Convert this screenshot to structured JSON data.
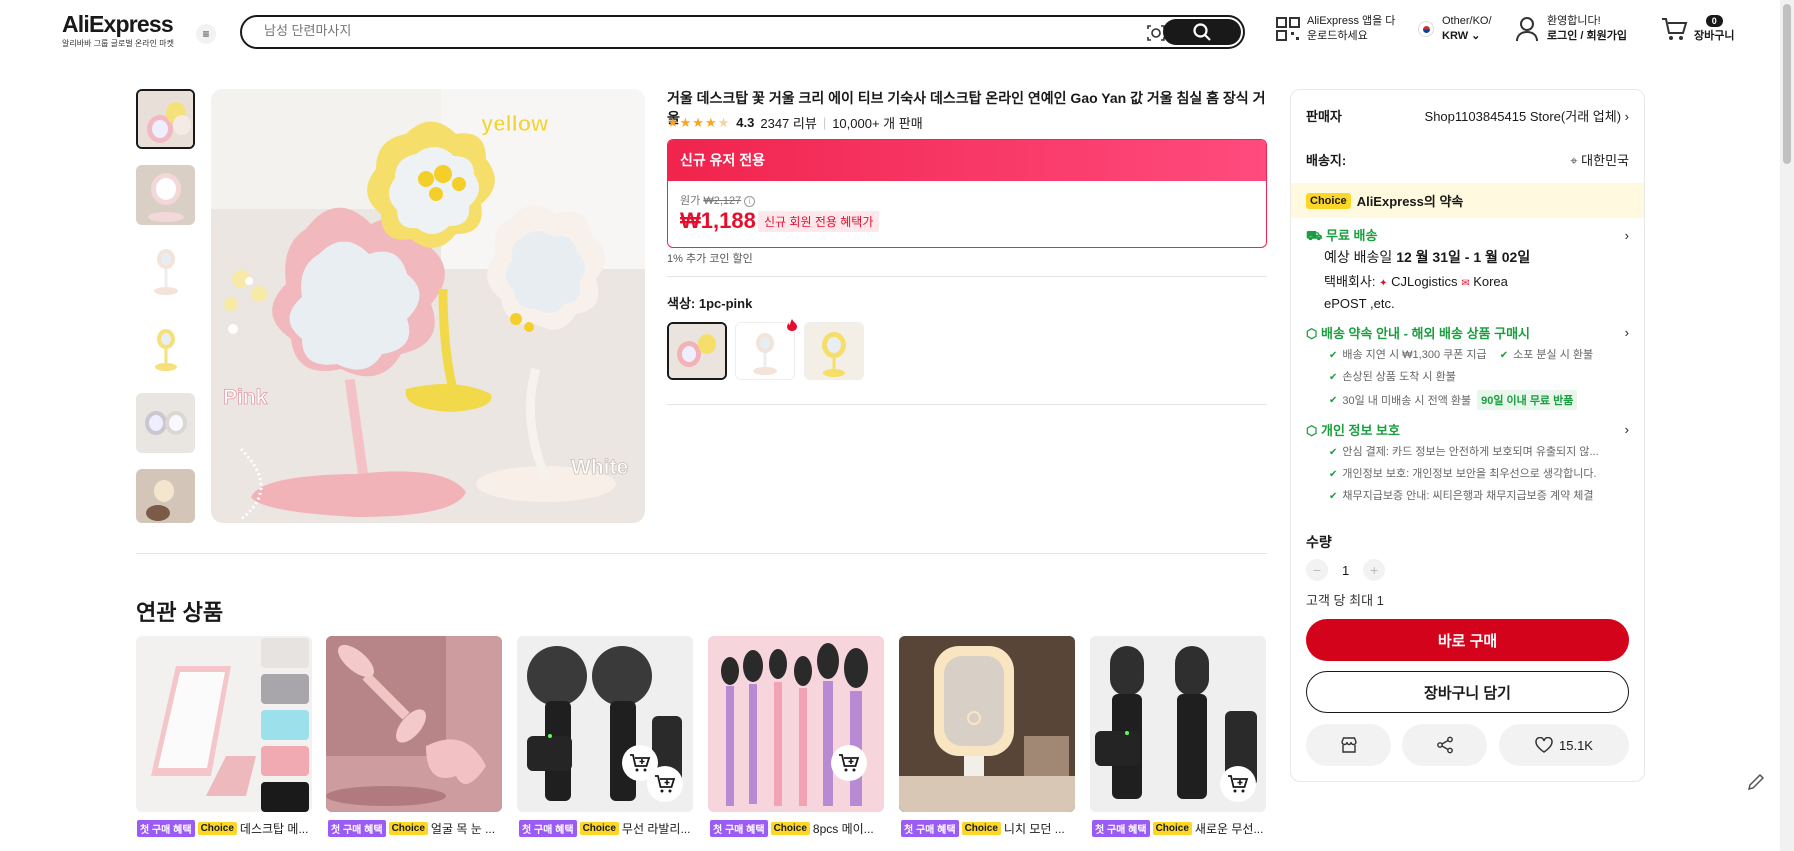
{
  "header": {
    "logo": "AliExpress",
    "logo_sub": "알리바바 그룹 글로벌 온라인 마켓",
    "search_placeholder": "남성 단련마사지",
    "app_line1": "AliExpress 앱을 다",
    "app_line2": "운로드하세요",
    "region_line1": "Other/KO/",
    "region_line2": "KRW",
    "account_line1": "환영합니다!",
    "account_line2": "로그인 / 회원가입",
    "cart_count": "0",
    "cart_label": "장바구니"
  },
  "product": {
    "title": "거울 데스크탑 꽃 거울 크리 에이 티브 기숙사 데스크탑 온라인 연예인 Gao Yan 값 거울 침실 홈 장식 거울",
    "rating": "4.3",
    "reviews": "2347 리뷰",
    "sold": "10,000+ 개 판매",
    "promo_header": "신규 유저 전용",
    "orig_label": "원가",
    "orig_price": "₩2,127",
    "price": "₩1,188",
    "price_badge": "신규 회원 전용 혜택가",
    "coin_note": "1% 추가 코인 할인",
    "color_label": "색상: 1pc-pink",
    "image_labels": {
      "yellow": "yellow",
      "pink": "Pink",
      "white": "White"
    }
  },
  "panel": {
    "seller_label": "판매자",
    "seller_name": "Shop1103845415 Store(거래 업체)",
    "ship_label": "배송지:",
    "ship_dest": "대한민국",
    "choice_tag": "Choice",
    "choice_text": "AliExpress의 약속",
    "free_ship": "무료 배송",
    "eta_prefix": "예상 배송일",
    "eta": "12 월 31일 - 1 월 02일",
    "carrier_prefix": "택배회사:",
    "carrier1": "CJLogistics",
    "carrier2": "Korea",
    "carrier3": "ePOST ,etc.",
    "promise_title": "배송 약속 안내 - 해외 배송 상품 구매시",
    "promise_items": [
      "배송 지연 시 ₩1,300 쿠폰 지급",
      "소포 분실 시 환불",
      "손상된 상품 도착 시 환불",
      "30일 내 미배송 시 전액 환불"
    ],
    "return_badge": "90일 이내 무료 반품",
    "privacy_title": "개인 정보 보호",
    "privacy_items": [
      "안심 결제: 카드 정보는 안전하게 보호되며 유출되지 않...",
      "개인정보 보호: 개인정보 보안을 최우선으로 생각합니다.",
      "채무지급보증 안내: 씨티은행과 채무지급보증 계약 체결"
    ],
    "qty_label": "수량",
    "qty": "1",
    "qty_limit": "고객 당 최대 1",
    "buy_now": "바로 구매",
    "add_cart": "장바구니 담기",
    "likes": "15.1K"
  },
  "related": {
    "title": "연관 상품",
    "tag1": "첫 구매 혜택",
    "tag2": "Choice",
    "items": [
      {
        "name": "데스크탑 메..."
      },
      {
        "name": "얼굴 목 눈 ..."
      },
      {
        "name": "무선 라발리..."
      },
      {
        "name": "8pcs 메이..."
      },
      {
        "name": "니치 모던 ..."
      },
      {
        "name": "새로운 무선..."
      }
    ]
  },
  "colors": {
    "accent_red": "#d3031c",
    "promo_pink": "#f0244d",
    "green": "#1a9e3f",
    "choice_yellow": "#fcd728"
  }
}
